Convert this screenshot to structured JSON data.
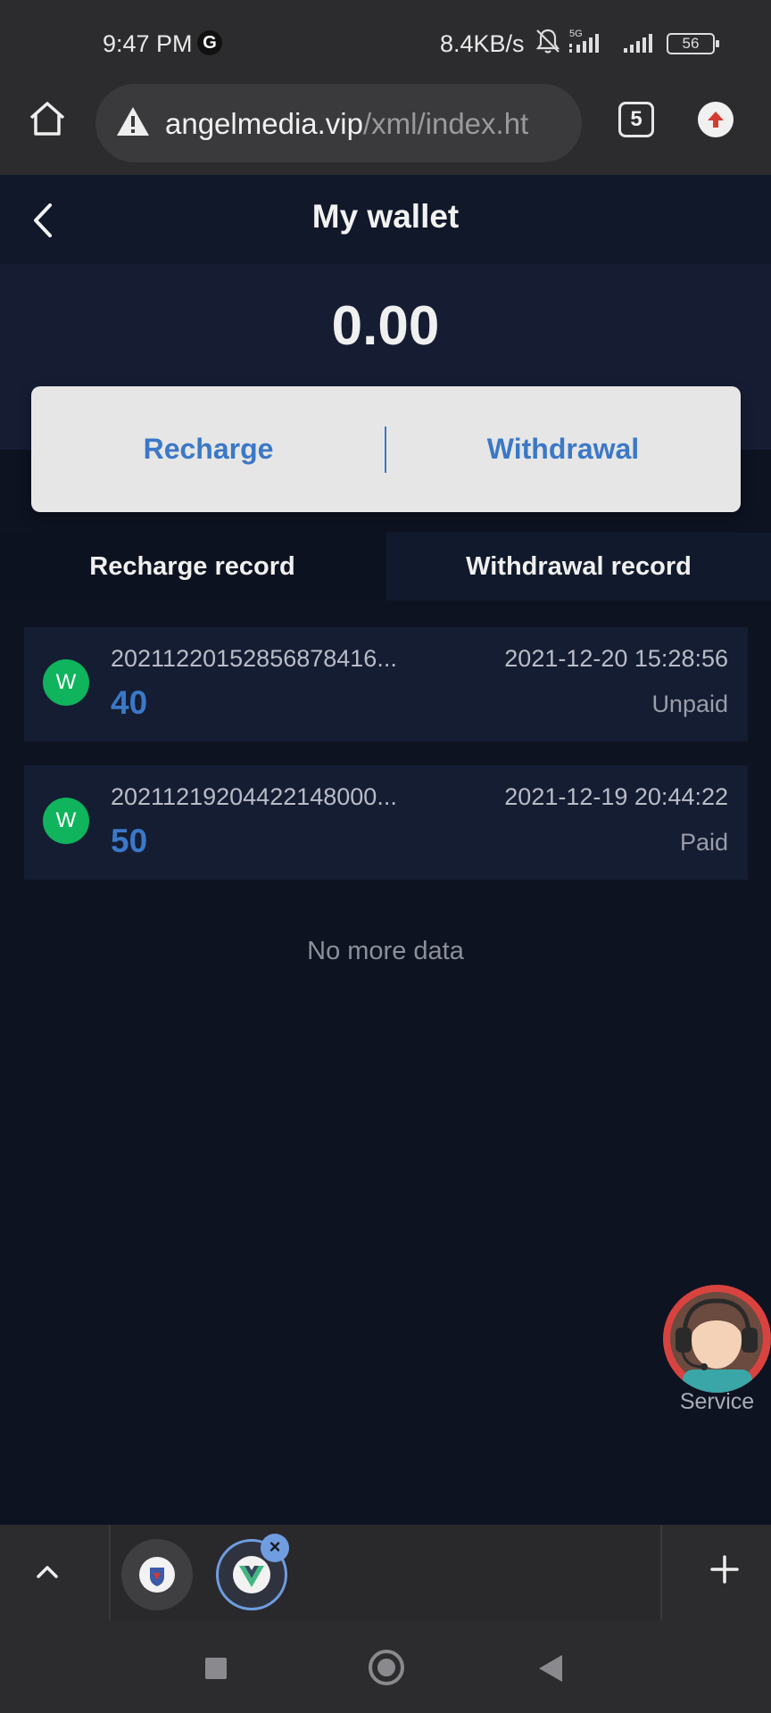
{
  "status_bar": {
    "time": "9:47 PM",
    "g_badge": "G",
    "net_speed": "8.4KB/s",
    "network_type": "5G",
    "battery": "56"
  },
  "browser": {
    "url_domain": "angelmedia.vip",
    "url_path": "/xml/index.ht",
    "tab_count": "5"
  },
  "page": {
    "title": "My wallet",
    "balance": "0.00",
    "actions": {
      "recharge": "Recharge",
      "withdrawal": "Withdrawal"
    },
    "tabs": {
      "recharge_record": "Recharge record",
      "withdrawal_record": "Withdrawal record"
    },
    "records": [
      {
        "avatar": "W",
        "id": "20211220152856878416...",
        "amount": "40",
        "date": "2021-12-20 15:28:56",
        "status": "Unpaid"
      },
      {
        "avatar": "W",
        "id": "20211219204422148000...",
        "amount": "50",
        "date": "2021-12-19 20:44:22",
        "status": "Paid"
      }
    ],
    "no_more": "No more data",
    "service_label": "Service"
  },
  "tab_strip": {
    "close_glyph": "×"
  },
  "colors": {
    "accent_blue": "#3b78c7",
    "avatar_green": "#0fb45c",
    "service_red": "#d9433f"
  }
}
